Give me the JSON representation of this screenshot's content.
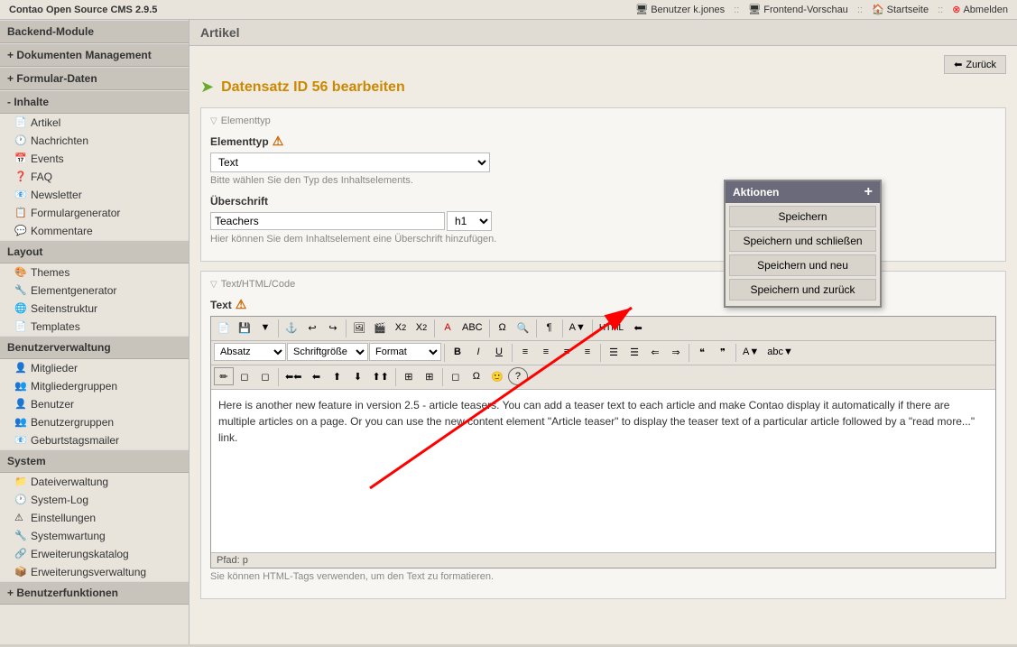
{
  "app": {
    "title": "Contao Open Source CMS 2.9.5"
  },
  "topbar": {
    "user": "Benutzer k.jones",
    "sep1": "::",
    "frontend": "Frontend-Vorschau",
    "sep2": "::",
    "startseite": "Startseite",
    "sep3": "::",
    "abmelden": "Abmelden"
  },
  "sidebar": {
    "title": "Backend-Module",
    "sections": [
      {
        "id": "dokumenten",
        "label": "+ Dokumenten Management",
        "items": []
      },
      {
        "id": "formular",
        "label": "+ Formular-Daten",
        "items": []
      },
      {
        "id": "inhalte",
        "label": "- Inhalte",
        "expanded": true,
        "items": [
          {
            "id": "artikel",
            "label": "Artikel",
            "icon": "📄"
          },
          {
            "id": "nachrichten",
            "label": "Nachrichten",
            "icon": "🕐"
          },
          {
            "id": "events",
            "label": "Events",
            "icon": "📅"
          },
          {
            "id": "faq",
            "label": "FAQ",
            "icon": "❓"
          },
          {
            "id": "newsletter",
            "label": "Newsletter",
            "icon": "📧"
          },
          {
            "id": "formulargenerator",
            "label": "Formulargenerator",
            "icon": "📋"
          },
          {
            "id": "kommentare",
            "label": "Kommentare",
            "icon": "💬"
          }
        ]
      },
      {
        "id": "layout",
        "label": "Layout",
        "expanded": true,
        "items": [
          {
            "id": "themes",
            "label": "Themes",
            "icon": "🎨"
          },
          {
            "id": "elementgenerator",
            "label": "Elementgenerator",
            "icon": "🔧"
          },
          {
            "id": "seitenstruktur",
            "label": "Seitenstruktur",
            "icon": "🌐"
          },
          {
            "id": "templates",
            "label": "Templates",
            "icon": "📄"
          }
        ]
      },
      {
        "id": "benutzerverwaltung",
        "label": "Benutzerverwaltung",
        "expanded": true,
        "items": [
          {
            "id": "mitglieder",
            "label": "Mitglieder",
            "icon": "👤"
          },
          {
            "id": "mitgliedergruppen",
            "label": "Mitgliedergruppen",
            "icon": "👥"
          },
          {
            "id": "benutzer",
            "label": "Benutzer",
            "icon": "👤"
          },
          {
            "id": "benutzergruppen",
            "label": "Benutzergruppen",
            "icon": "👥"
          },
          {
            "id": "geburtstagsmailer",
            "label": "Geburtstagsmailer",
            "icon": "📧"
          }
        ]
      },
      {
        "id": "system",
        "label": "System",
        "expanded": true,
        "items": [
          {
            "id": "dateiverwaltung",
            "label": "Dateiverwaltung",
            "icon": "📁"
          },
          {
            "id": "system-log",
            "label": "System-Log",
            "icon": "🕐"
          },
          {
            "id": "einstellungen",
            "label": "Einstellungen",
            "icon": "⚠"
          },
          {
            "id": "systemwartung",
            "label": "Systemwartung",
            "icon": "🔧"
          },
          {
            "id": "erweiterungskatalog",
            "label": "Erweiterungskatalog",
            "icon": "🔗"
          },
          {
            "id": "erweiterungsverwaltung",
            "label": "Erweiterungsverwaltung",
            "icon": "📦"
          }
        ]
      },
      {
        "id": "benutzerfunktionen",
        "label": "Benutzerfunktionen",
        "expanded": false,
        "items": []
      }
    ]
  },
  "content": {
    "article_header": "Artikel",
    "back_label": "Zurück",
    "page_title": "Datensatz ID 56 bearbeiten",
    "elementtyp_legend": "Elementtyp",
    "elementtyp_label": "Elementtyp",
    "elementtyp_value": "Text",
    "elementtyp_hint": "Bitte wählen Sie den Typ des Inhaltselements.",
    "ueberschrift_label": "Überschrift",
    "ueberschrift_value": "Teachers",
    "ueberschrift_h_value": "h1",
    "ueberschrift_hint": "Hier können Sie dem Inhaltselement eine Überschrift hinzufügen.",
    "text_html_legend": "Text/HTML/Code",
    "text_label": "Text",
    "editor_path": "Pfad: p",
    "editor_hint": "Sie können HTML-Tags verwenden, um den Text zu formatieren.",
    "editor_content": "Here is another new feature in version 2.5 - article teasers. You can add a teaser text to each article and make Contao display it automatically if there are multiple articles on a page. Or you can use the new content element \"Article teaser\" to display the teaser text of a particular article followed by a \"read more...\" link.",
    "toolbar": {
      "row1": {
        "style_select": "Absatz",
        "fontsize_select": "Schriftgröße",
        "format_select": "Format",
        "bold": "B",
        "italic": "I",
        "underline": "U",
        "align_left": "≡",
        "align_center": "≡",
        "align_right": "≡",
        "align_justify": "≡",
        "list_ul": "☰",
        "list_ol": "☰",
        "outdent": "⇐",
        "indent": "⇒",
        "blockquote": "❝",
        "source": "HTML"
      }
    }
  },
  "aktionen": {
    "title": "Aktionen",
    "plus": "+",
    "buttons": [
      {
        "id": "speichern",
        "label": "Speichern"
      },
      {
        "id": "speichern-schliessen",
        "label": "Speichern und schließen"
      },
      {
        "id": "speichern-neu",
        "label": "Speichern und neu"
      },
      {
        "id": "speichern-zurueck",
        "label": "Speichern und zurück"
      }
    ]
  }
}
